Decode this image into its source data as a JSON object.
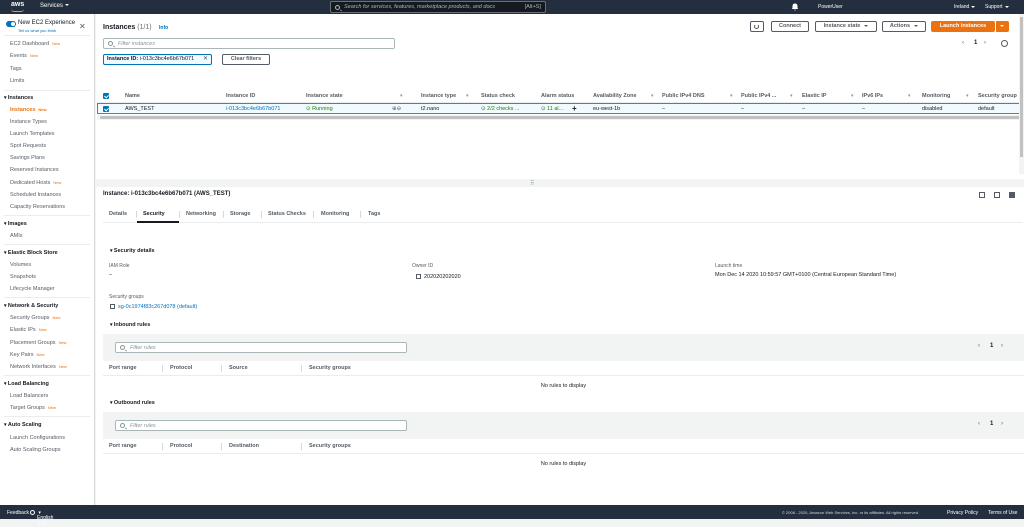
{
  "topbar": {
    "logo": "aws",
    "services": "Services",
    "search_placeholder": "Search for services, features, marketplace products, and docs",
    "search_shortcut": "[Alt+S]",
    "user": "PowerUser",
    "region": "Ireland",
    "support": "Support"
  },
  "sidebar": {
    "new_experience": "New EC2 Experience",
    "tell_us": "Tell us what you think",
    "new_badge": "New",
    "items_top": [
      "EC2 Dashboard",
      "Events",
      "Tags",
      "Limits"
    ],
    "sections": [
      {
        "title": "Instances",
        "items": [
          "Instances",
          "Instance Types",
          "Launch Templates",
          "Spot Requests",
          "Savings Plans",
          "Reserved Instances",
          "Dedicated Hosts",
          "Scheduled Instances",
          "Capacity Reservations"
        ]
      },
      {
        "title": "Images",
        "items": [
          "AMIs"
        ]
      },
      {
        "title": "Elastic Block Store",
        "items": [
          "Volumes",
          "Snapshots",
          "Lifecycle Manager"
        ]
      },
      {
        "title": "Network & Security",
        "items": [
          "Security Groups",
          "Elastic IPs",
          "Placement Groups",
          "Key Pairs",
          "Network Interfaces"
        ]
      },
      {
        "title": "Load Balancing",
        "items": [
          "Load Balancers",
          "Target Groups"
        ]
      },
      {
        "title": "Auto Scaling",
        "items": [
          "Launch Configurations",
          "Auto Scaling Groups"
        ]
      }
    ]
  },
  "instances_panel": {
    "title": "Instances",
    "count": "(1/1)",
    "info": "Info",
    "connect": "Connect",
    "instance_state": "Instance state",
    "actions": "Actions",
    "launch": "Launch instances",
    "filter_placeholder": "Filter instances",
    "token_key": "Instance ID:",
    "token_value": "i-013c3bc4e6b67b071",
    "clear_filters": "Clear filters",
    "page": "1",
    "columns": [
      "Name",
      "Instance ID",
      "Instance state",
      "Instance type",
      "Status check",
      "Alarm status",
      "Availability Zone",
      "Public IPv4 DNS",
      "Public IPv4 ...",
      "Elastic IP",
      "IPv6 IPs",
      "Monitoring",
      "Security group"
    ],
    "row": {
      "name": "AWS_TEST",
      "id": "i-013c3bc4e6b67b071",
      "state": "Running",
      "type": "t2.nano",
      "status_check": "2/2 checks ...",
      "alarm": "11 al...",
      "az": "eu-west-1b",
      "dns": "–",
      "ipv4": "–",
      "eip": "–",
      "ipv6": "–",
      "monitoring": "disabled",
      "sg": "default"
    }
  },
  "detail": {
    "title": "Instance: i-013c3bc4e6b67b071 (AWS_TEST)",
    "tabs": [
      "Details",
      "Security",
      "Networking",
      "Storage",
      "Status Checks",
      "Monitoring",
      "Tags"
    ],
    "security_details": "Security details",
    "iam_role_label": "IAM Role",
    "iam_role_value": "–",
    "owner_label": "Owner ID",
    "owner_value": "202020202020",
    "launch_label": "Launch time",
    "launch_value": "Mon Dec 14 2020 10:59:57 GMT+0100 (Central European Standard Time)",
    "sg_label": "Security groups",
    "sg_value": "sg-0c1974f83c267d078 (default)",
    "inbound": "Inbound rules",
    "outbound": "Outbound rules",
    "filter_rules": "Filter rules",
    "rules_page": "1",
    "inbound_cols": [
      "Port range",
      "Protocol",
      "Source",
      "Security groups"
    ],
    "outbound_cols": [
      "Port range",
      "Protocol",
      "Destination",
      "Security groups"
    ],
    "no_rules": "No rules to display"
  },
  "footer": {
    "feedback": "Feedback",
    "language": "English (US)",
    "copyright": "© 2008 - 2020, Amazon Web Services, Inc. or its affiliates. All rights reserved.",
    "privacy": "Privacy Policy",
    "terms": "Terms of Use"
  },
  "colors": {
    "nav": "#232f3e",
    "accent": "#ec7211",
    "link": "#0073bb",
    "ok": "#1d8102"
  }
}
